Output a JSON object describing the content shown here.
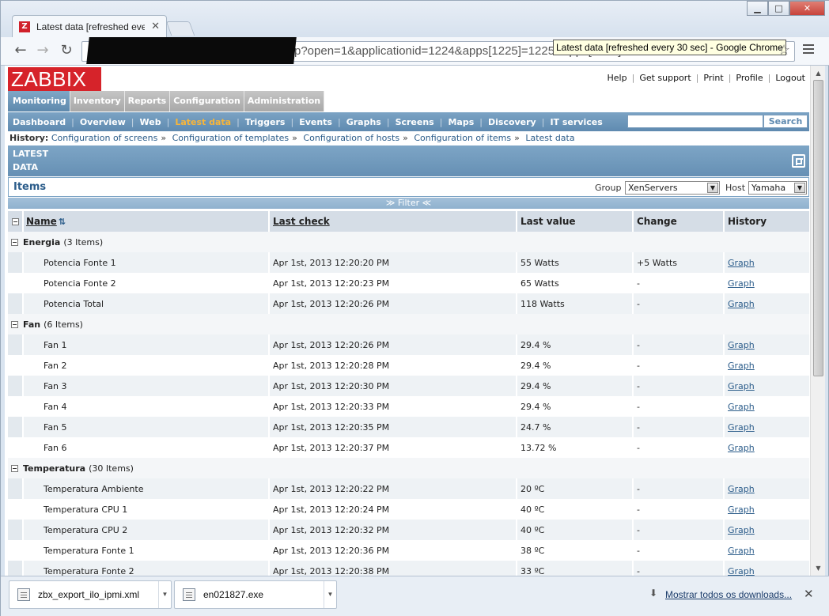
{
  "browser": {
    "tab_title": "Latest data [refreshed every 30 sec] - Google Chrome",
    "tab_title_short": "Latest data [refreshed ever",
    "url_visible": "p?open=1&applicationid=1224&apps[1225]=1225&apps[1226]",
    "tooltip": "Latest data [refreshed every 30 sec] - Google Chrome",
    "win_minimize": "▁",
    "win_maximize": "□",
    "win_close": "✕"
  },
  "header": {
    "logo": "ZABBIX",
    "links": [
      "Help",
      "Get support",
      "Print",
      "Profile",
      "Logout"
    ]
  },
  "main_menu": [
    "Monitoring",
    "Inventory",
    "Reports",
    "Configuration",
    "Administration"
  ],
  "sub_menu": [
    "Dashboard",
    "Overview",
    "Web",
    "Latest data",
    "Triggers",
    "Events",
    "Graphs",
    "Screens",
    "Maps",
    "Discovery",
    "IT services"
  ],
  "search": {
    "button": "Search",
    "value": ""
  },
  "history": {
    "label": "History:",
    "items": [
      "Configuration of screens",
      "Configuration of templates",
      "Configuration of hosts",
      "Configuration of items",
      "Latest data"
    ]
  },
  "section": {
    "title_line1": "LATEST",
    "title_line2": "DATA"
  },
  "items_bar": {
    "title": "Items",
    "group_label": "Group",
    "group_value": "XenServers",
    "host_label": "Host",
    "host_value": "Yamaha"
  },
  "filter": {
    "label": "≫ Filter ≪"
  },
  "table": {
    "headers": {
      "name": "Name",
      "last_check": "Last check",
      "last_value": "Last value",
      "change": "Change",
      "history": "History"
    },
    "groups": [
      {
        "name": "Energia",
        "count": "(3 Items)",
        "items": [
          {
            "name": "Potencia Fonte 1",
            "last_check": "Apr 1st, 2013 12:20:20 PM",
            "last_value": "55 Watts",
            "change": "+5 Watts",
            "history": "Graph"
          },
          {
            "name": "Potencia Fonte 2",
            "last_check": "Apr 1st, 2013 12:20:23 PM",
            "last_value": "65 Watts",
            "change": "-",
            "history": "Graph"
          },
          {
            "name": "Potencia Total",
            "last_check": "Apr 1st, 2013 12:20:26 PM",
            "last_value": "118 Watts",
            "change": "-",
            "history": "Graph"
          }
        ]
      },
      {
        "name": "Fan",
        "count": "(6 Items)",
        "items": [
          {
            "name": "Fan 1",
            "last_check": "Apr 1st, 2013 12:20:26 PM",
            "last_value": "29.4 %",
            "change": "-",
            "history": "Graph"
          },
          {
            "name": "Fan 2",
            "last_check": "Apr 1st, 2013 12:20:28 PM",
            "last_value": "29.4 %",
            "change": "-",
            "history": "Graph"
          },
          {
            "name": "Fan 3",
            "last_check": "Apr 1st, 2013 12:20:30 PM",
            "last_value": "29.4 %",
            "change": "-",
            "history": "Graph"
          },
          {
            "name": "Fan 4",
            "last_check": "Apr 1st, 2013 12:20:33 PM",
            "last_value": "29.4 %",
            "change": "-",
            "history": "Graph"
          },
          {
            "name": "Fan 5",
            "last_check": "Apr 1st, 2013 12:20:35 PM",
            "last_value": "24.7 %",
            "change": "-",
            "history": "Graph"
          },
          {
            "name": "Fan 6",
            "last_check": "Apr 1st, 2013 12:20:37 PM",
            "last_value": "13.72 %",
            "change": "-",
            "history": "Graph"
          }
        ]
      },
      {
        "name": "Temperatura",
        "count": "(30 Items)",
        "items": [
          {
            "name": "Temperatura Ambiente",
            "last_check": "Apr 1st, 2013 12:20:22 PM",
            "last_value": "20 ºC",
            "change": "-",
            "history": "Graph"
          },
          {
            "name": "Temperatura CPU 1",
            "last_check": "Apr 1st, 2013 12:20:24 PM",
            "last_value": "40 ºC",
            "change": "-",
            "history": "Graph"
          },
          {
            "name": "Temperatura CPU 2",
            "last_check": "Apr 1st, 2013 12:20:32 PM",
            "last_value": "40 ºC",
            "change": "-",
            "history": "Graph"
          },
          {
            "name": "Temperatura Fonte 1",
            "last_check": "Apr 1st, 2013 12:20:36 PM",
            "last_value": "38 ºC",
            "change": "-",
            "history": "Graph"
          },
          {
            "name": "Temperatura Fonte 2",
            "last_check": "Apr 1st, 2013 12:20:38 PM",
            "last_value": "33 ºC",
            "change": "-",
            "history": "Graph"
          }
        ]
      }
    ]
  },
  "downloads": {
    "items": [
      "zbx_export_ilo_ipmi.xml",
      "en021827.exe"
    ],
    "show_all": "Mostrar todos os downloads..."
  },
  "colors": {
    "logo_red": "#d6232a",
    "menu_blue": "#5f8ab0",
    "active_submenu": "#f7b53a",
    "link_blue": "#2b5c8a"
  }
}
